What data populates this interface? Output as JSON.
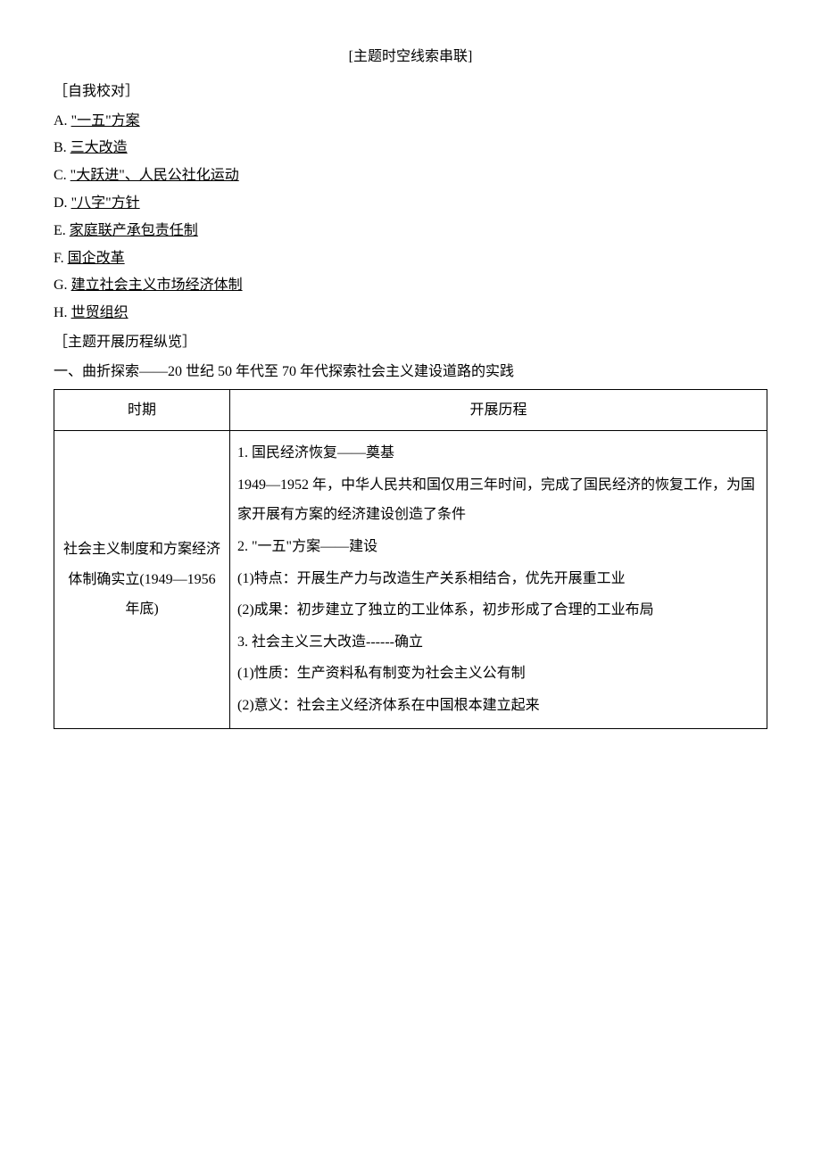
{
  "title": "[主题时空线索串联]",
  "selfCheck": "［自我校对］",
  "items": {
    "A": {
      "prefix": "A. ",
      "text": "\"一五\"方案"
    },
    "B": {
      "prefix": "B. ",
      "text": "三大改造"
    },
    "C": {
      "prefix": "C.  ",
      "text": "\"大跃进\"、人民公社化运动"
    },
    "D": {
      "prefix": "D. ",
      "text": "\"八字\"方针"
    },
    "E": {
      "prefix": "E. ",
      "text": "家庭联产承包责任制"
    },
    "F": {
      "prefix": "F. ",
      "text": "国企改革"
    },
    "G": {
      "prefix": "G. ",
      "text": "建立社会主义市场经济体制"
    },
    "H": {
      "prefix": "H. ",
      "text": "世贸组织"
    }
  },
  "devLabel": "［主题开展历程纵览］",
  "sectionOne": "一、曲折探索——20 世纪 50 年代至 70 年代探索社会主义建设道路的实践",
  "table": {
    "header": {
      "period": "时期",
      "process": "开展历程"
    },
    "row1": {
      "period": "社会主义制度和方案经济体制确实立(1949—1956 年底)",
      "lines": {
        "l1": "1. 国民经济恢复——奠基",
        "l2": "1949—1952 年，中华人民共和国仅用三年时间，完成了国民经济的恢复工作，为国家开展有方案的经济建设创造了条件",
        "l3": "2. \"一五\"方案——建设",
        "l4": "(1)特点：开展生产力与改造生产关系相结合，优先开展重工业",
        "l5": "(2)成果：初步建立了独立的工业体系，初步形成了合理的工业布局",
        "l6": "3. 社会主义三大改造------确立",
        "l7": "(1)性质：生产资料私有制变为社会主义公有制",
        "l8": "(2)意义：社会主义经济体系在中国根本建立起来"
      }
    }
  }
}
